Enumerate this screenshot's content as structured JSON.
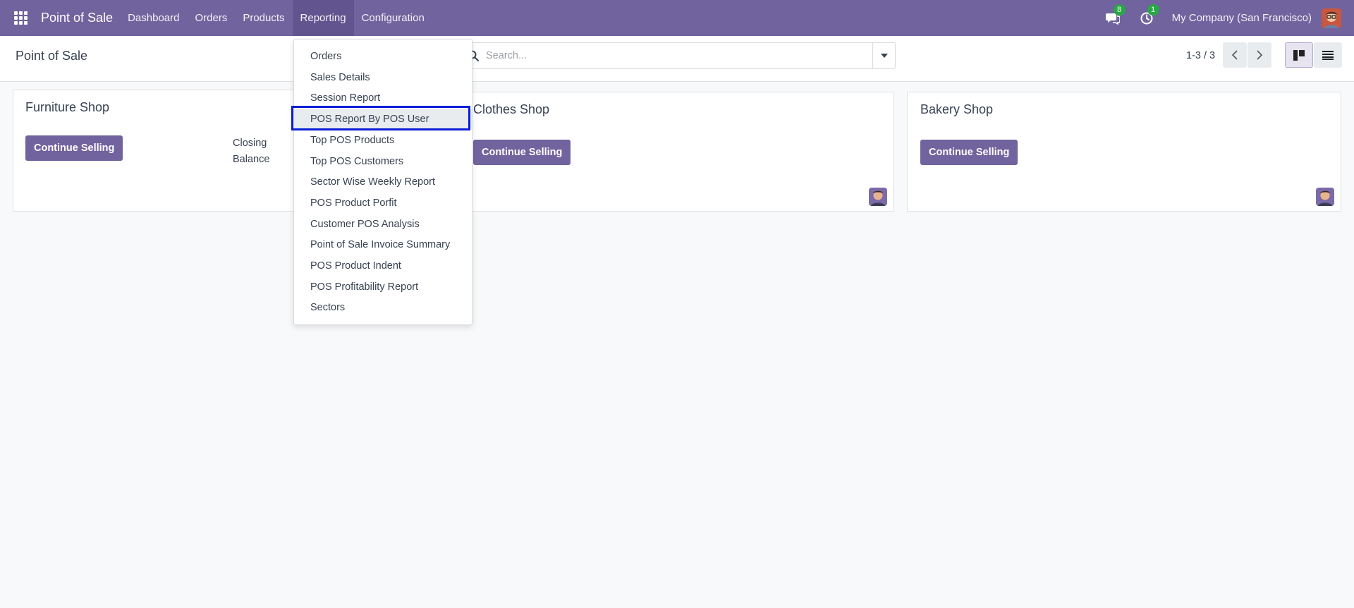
{
  "navbar": {
    "brand": "Point of Sale",
    "menu": [
      "Dashboard",
      "Orders",
      "Products",
      "Reporting",
      "Configuration"
    ],
    "messages_count": "8",
    "activities_count": "1",
    "company": "My Company (San Francisco)"
  },
  "control_panel": {
    "title": "Point of Sale",
    "search_placeholder": "Search...",
    "pager": "1-3 / 3"
  },
  "cards": [
    {
      "title": "Furniture Shop",
      "button": "Continue Selling",
      "closing_label_1": "Closing",
      "closing_label_2": "Balance"
    },
    {
      "title": "Clothes Shop",
      "button": "Continue Selling"
    },
    {
      "title": "Bakery Shop",
      "button": "Continue Selling"
    }
  ],
  "reporting_menu": [
    "Orders",
    "Sales Details",
    "Session Report",
    "POS Report By POS User",
    "Top POS Products",
    "Top POS Customers",
    "Sector Wise Weekly Report",
    "POS Product Porfit",
    "Customer POS Analysis",
    "Point of Sale Invoice Summary",
    "POS Product Indent",
    "POS Profitability Report",
    "Sectors"
  ],
  "colors": {
    "brand": "#71639e",
    "highlight_border": "#0a1fd4",
    "badge": "#28a745"
  }
}
